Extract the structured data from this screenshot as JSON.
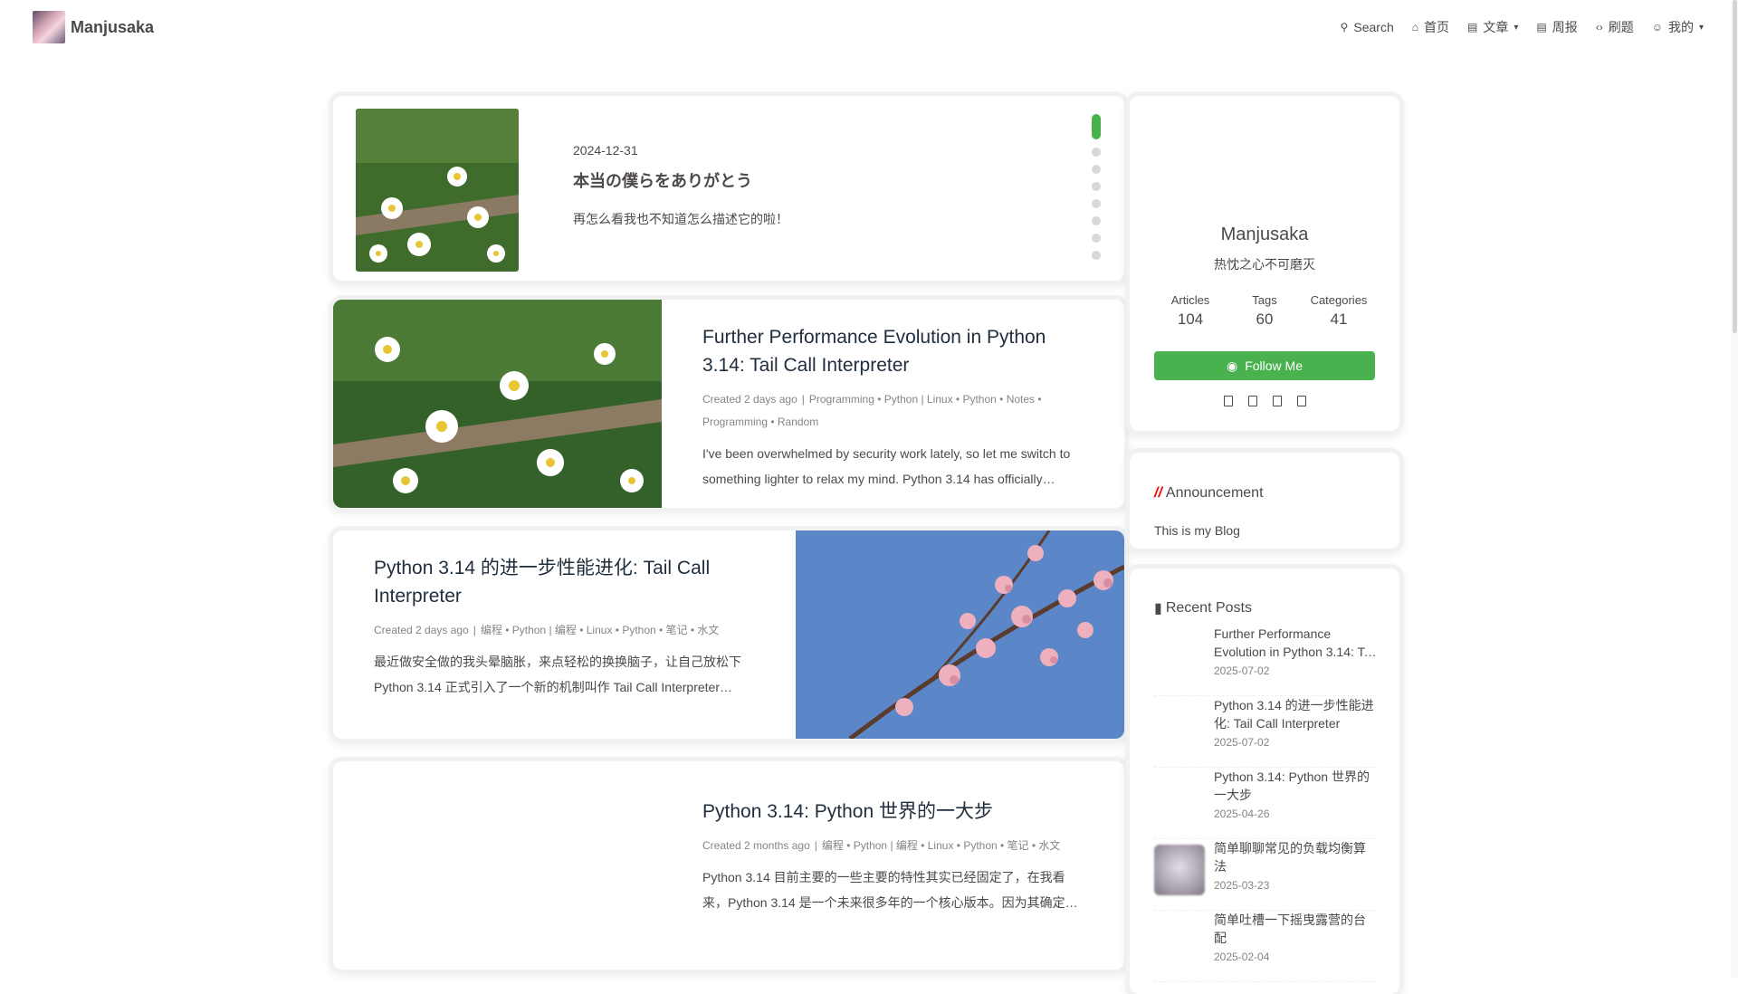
{
  "site": {
    "name": "Manjusaka"
  },
  "nav": {
    "items": [
      {
        "label": "Search",
        "icon": "search-icon",
        "has_caret": false
      },
      {
        "label": "首页",
        "icon": "home-icon",
        "has_caret": false
      },
      {
        "label": "文章",
        "icon": "archive-icon",
        "has_caret": true
      },
      {
        "label": "周报",
        "icon": "newspaper-icon",
        "has_caret": false
      },
      {
        "label": "刷题",
        "icon": "code-icon",
        "has_caret": false
      },
      {
        "label": "我的",
        "icon": "user-icon",
        "has_caret": true
      }
    ]
  },
  "carousel": {
    "date": "2024-12-31",
    "title": "本当の僕らをありがとう",
    "desc": "再怎么看我也不知道怎么描述它的啦！",
    "dot_count": 8,
    "active_dot": 0
  },
  "posts": [
    {
      "title": "Further Performance Evolution in Python 3.14: Tail Call Interpreter",
      "created": "Created 2 days ago",
      "meta": "Programming • Python | Linux • Python • Notes • Programming • Random",
      "excerpt": "I've been overwhelmed by security work lately, so let me switch to something lighter to relax my mind. Python 3.14 has officially…",
      "image": "daisy",
      "image_side": "left"
    },
    {
      "title": "Python 3.14 的进一步性能进化: Tail Call Interpreter",
      "created": "Created 2 days ago",
      "meta": "编程 • Python | 编程 • Linux • Python • 笔记 • 水文",
      "excerpt": "最近做安全做的我头晕脑胀，来点轻松的换换脑子，让自己放松下 Python 3.14 正式引入了一个新的机制叫作 Tail Call Interpreter…",
      "image": "blossom",
      "image_side": "right"
    },
    {
      "title": "Python 3.14: Python 世界的一大步",
      "created": "Created 2 months ago",
      "meta": "编程 • Python | 编程 • Linux • Python • 笔记 • 水文",
      "excerpt": "Python 3.14 目前主要的一些主要的特性其实已经固定了，在我看来，Python 3.14 是一个未来很多年的一个核心版本。因为其确定…",
      "image": "none",
      "image_side": "left"
    }
  ],
  "author": {
    "name": "Manjusaka",
    "desc": "热忱之心不可磨灭",
    "stats": [
      {
        "label": "Articles",
        "value": "104"
      },
      {
        "label": "Tags",
        "value": "60"
      },
      {
        "label": "Categories",
        "value": "41"
      }
    ],
    "follow_label": "Follow Me",
    "social_icons": [
      "github-icon",
      "twitter-icon",
      "mail-icon",
      "rss-icon"
    ]
  },
  "announcement": {
    "title": "Announcement",
    "text": "This is my Blog"
  },
  "recent": {
    "title": "Recent Posts",
    "items": [
      {
        "title": "Further Performance Evolution in Python 3.14: Tail Call Interpreter",
        "date": "2025-07-02",
        "thumb": "none"
      },
      {
        "title": "Python 3.14 的进一步性能进化: Tail Call Interpreter",
        "date": "2025-07-02",
        "thumb": "none"
      },
      {
        "title": "Python 3.14: Python 世界的一大步",
        "date": "2025-04-26",
        "thumb": "none"
      },
      {
        "title": "简单聊聊常见的负载均衡算法",
        "date": "2025-03-23",
        "thumb": "blur"
      },
      {
        "title": "简单吐槽一下摇曳露营的台配",
        "date": "2025-02-04",
        "thumb": "none"
      }
    ]
  },
  "colors": {
    "accent": "#49b14e",
    "text": "#4c4948",
    "meta": "#858585"
  }
}
